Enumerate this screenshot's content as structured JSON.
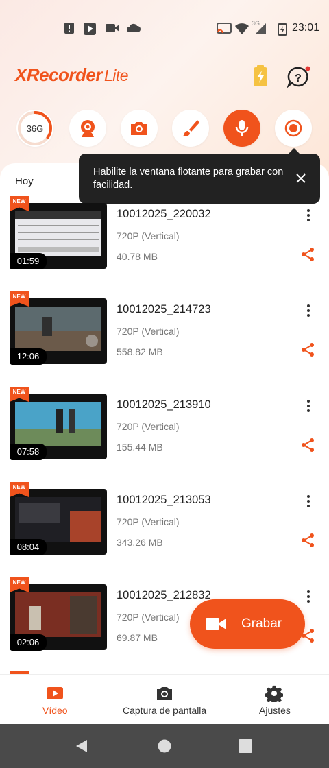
{
  "status_bar": {
    "time": "23:01",
    "network": "3G",
    "icons": [
      "alert-icon",
      "play-store-icon",
      "video-icon",
      "cloud-icon",
      "cast-icon",
      "wifi-icon",
      "cellular-icon",
      "battery-icon"
    ]
  },
  "header": {
    "app_name": "XRecorder",
    "app_suffix": "Lite",
    "brand_color": "#f0531c"
  },
  "tools": {
    "storage_label": "36G",
    "storage_used_fraction": 0.35,
    "items": [
      "webcam-icon",
      "camera-icon",
      "brush-icon",
      "microphone-icon",
      "record-icon"
    ]
  },
  "tooltip": {
    "text": "Habilite la ventana flotante para grabar con facilidad."
  },
  "list": {
    "day_label": "Hoy",
    "badge_label": "NEW",
    "videos": [
      {
        "title": "10012025_220032",
        "resolution": "720P (Vertical)",
        "size": "40.78 MB",
        "duration": "01:59"
      },
      {
        "title": "10012025_214723",
        "resolution": "720P (Vertical)",
        "size": "558.82 MB",
        "duration": "12:06"
      },
      {
        "title": "10012025_213910",
        "resolution": "720P (Vertical)",
        "size": "155.44 MB",
        "duration": "07:58"
      },
      {
        "title": "10012025_213053",
        "resolution": "720P (Vertical)",
        "size": "343.26 MB",
        "duration": "08:04"
      },
      {
        "title": "10012025_212832",
        "resolution": "720P (Vertical)",
        "size": "69.87 MB",
        "duration": "02:06"
      }
    ]
  },
  "fab": {
    "label": "Grabar"
  },
  "bottom_nav": {
    "items": [
      {
        "label": "Vídeo",
        "icon": "video-tab-icon",
        "active": true
      },
      {
        "label": "Captura de pantalla",
        "icon": "camera-tab-icon",
        "active": false
      },
      {
        "label": "Ajustes",
        "icon": "gear-icon",
        "active": false
      }
    ]
  }
}
